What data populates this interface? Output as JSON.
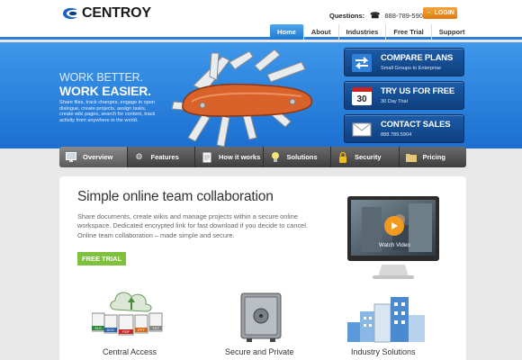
{
  "brand": {
    "name": "CENTROY"
  },
  "contact": {
    "questions_label": "Questions:",
    "phone": "888-789-5904"
  },
  "login": {
    "label": "LOGIN"
  },
  "top_nav": {
    "items": [
      {
        "label": "Home",
        "active": true
      },
      {
        "label": "About",
        "active": false
      },
      {
        "label": "Industries",
        "active": false
      },
      {
        "label": "Free Trial",
        "active": false
      },
      {
        "label": "Support",
        "active": false
      }
    ]
  },
  "hero": {
    "line1": "WORK BETTER.",
    "line2": "WORK EASIER.",
    "description": "Share files, track changes, engage in open dialogue, create projects, assign tasks, create wiki pages, search for content, track activity from anywhere in the world."
  },
  "cta": [
    {
      "title": "COMPARE PLANS",
      "subtitle": "Small Groups to Enterprise",
      "icon": "compare-arrows-icon"
    },
    {
      "title": "TRY US FOR FREE",
      "subtitle": "30 Day Trial",
      "icon": "calendar-icon",
      "badge": "30"
    },
    {
      "title": "CONTACT SALES",
      "subtitle": "888.789.5904",
      "icon": "envelope-icon"
    }
  ],
  "feature_nav": {
    "items": [
      {
        "label": "Overview",
        "icon": "monitor-icon",
        "active": true
      },
      {
        "label": "Features",
        "icon": "gear-icon",
        "active": false
      },
      {
        "label": "How it works",
        "icon": "document-icon",
        "active": false
      },
      {
        "label": "Solutions",
        "icon": "lightbulb-icon",
        "active": false
      },
      {
        "label": "Security",
        "icon": "padlock-icon",
        "active": false
      },
      {
        "label": "Pricing",
        "icon": "folder-icon",
        "active": false
      }
    ]
  },
  "main": {
    "title": "Simple online team collaboration",
    "text": "Share documents, create wikis and manage projects within a secure online workspace. Dedicated encrypted link for fast download if you decide to cancel. Online team collaboration – made simple and secure.",
    "free_trial": "FREE TRIAL",
    "video_label": "Watch Video"
  },
  "features": [
    {
      "label": "Central Access",
      "icon": "cloud-files-icon",
      "file_tags": [
        "XLS",
        "DOC",
        "PDF",
        "PPT",
        "TXT"
      ]
    },
    {
      "label": "Secure and Private",
      "icon": "safe-icon"
    },
    {
      "label": "Industry Solutions",
      "icon": "buildings-icon"
    }
  ],
  "colors": {
    "accent_blue": "#2a7fd6",
    "cta_navy": "#0f3f7e",
    "login_orange": "#f39a2e",
    "free_green": "#7fc03c"
  }
}
